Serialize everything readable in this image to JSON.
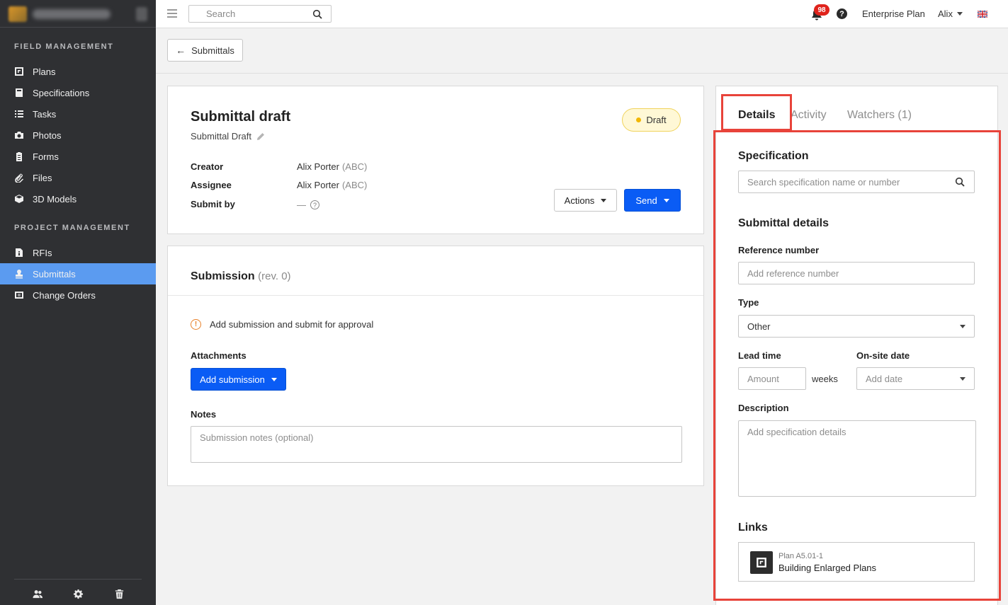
{
  "sidebar": {
    "sections": [
      {
        "title": "FIELD MANAGEMENT"
      },
      {
        "title": "PROJECT MANAGEMENT"
      }
    ],
    "items": [
      {
        "label": "Plans",
        "icon": "plans-icon"
      },
      {
        "label": "Specifications",
        "icon": "book-icon"
      },
      {
        "label": "Tasks",
        "icon": "list-icon"
      },
      {
        "label": "Photos",
        "icon": "camera-icon"
      },
      {
        "label": "Forms",
        "icon": "clipboard-icon"
      },
      {
        "label": "Files",
        "icon": "paperclip-icon"
      },
      {
        "label": "3D Models",
        "icon": "cube-icon"
      },
      {
        "label": "RFIs",
        "icon": "rfi-icon"
      },
      {
        "label": "Submittals",
        "icon": "stamp-icon",
        "active": true
      },
      {
        "label": "Change Orders",
        "icon": "change-orders-icon"
      }
    ],
    "bottom_icons": [
      "people-icon",
      "gear-icon",
      "trash-icon"
    ]
  },
  "topbar": {
    "search_placeholder": "Search",
    "notification_count": "98",
    "help": "?",
    "plan_label": "Enterprise Plan",
    "user_name": "Alix",
    "flag": "uk-flag-icon"
  },
  "subbar": {
    "back_label": "Submittals"
  },
  "header_card": {
    "title": "Submittal draft",
    "subtitle": "Submittal Draft",
    "status": "Draft",
    "status_color": "#f2b705",
    "creator_label": "Creator",
    "creator_name": "Alix Porter",
    "creator_org": "(ABC)",
    "assignee_label": "Assignee",
    "assignee_name": "Alix Porter",
    "assignee_org": "(ABC)",
    "submit_by_label": "Submit by",
    "submit_by_value": "—",
    "actions_label": "Actions",
    "send_label": "Send"
  },
  "submission": {
    "title": "Submission",
    "rev": "(rev. 0)",
    "warning": "Add submission and submit for approval",
    "attachments_label": "Attachments",
    "add_submission_label": "Add submission",
    "notes_label": "Notes",
    "notes_placeholder": "Submission notes (optional)"
  },
  "right_panel": {
    "tabs": [
      {
        "label": "Details",
        "active": true
      },
      {
        "label": "Activity",
        "active": false
      },
      {
        "label": "Watchers (1)",
        "active": false
      }
    ],
    "specification_heading": "Specification",
    "specification_placeholder": "Search specification name or number",
    "details_heading": "Submittal details",
    "reference_label": "Reference number",
    "reference_placeholder": "Add reference number",
    "type_label": "Type",
    "type_value": "Other",
    "lead_time_label": "Lead time",
    "lead_time_placeholder": "Amount",
    "lead_time_unit": "weeks",
    "onsite_label": "On-site date",
    "onsite_placeholder": "Add date",
    "description_label": "Description",
    "description_placeholder": "Add specification details",
    "links_heading": "Links",
    "link_type": "Plan A5.01-1",
    "link_name": "Building Enlarged Plans"
  },
  "colors": {
    "accent": "#0a5cf5",
    "sidebar_active": "#5b9bf0",
    "highlight": "#e8433a",
    "badge": "#e0231c"
  }
}
